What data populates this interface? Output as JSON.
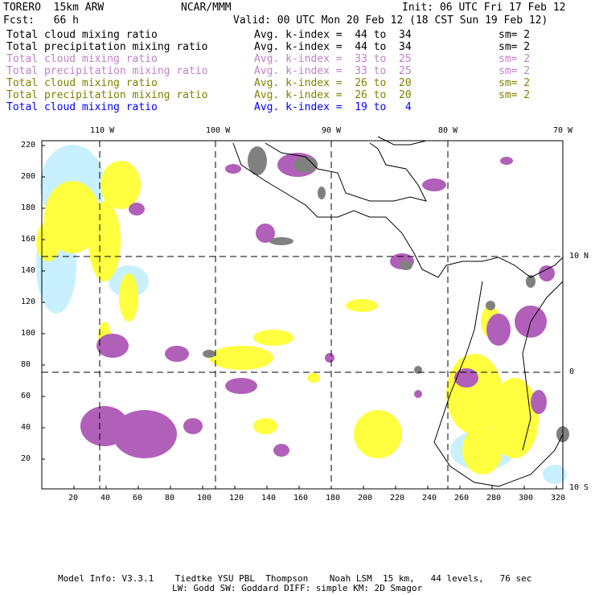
{
  "header": {
    "model": "TORERO  15km ARW",
    "org": "NCAR/MMM",
    "init": "Init: 06 UTC Fri 17 Feb 12",
    "fcst": "Fcst:   66 h",
    "valid": "Valid: 00 UTC Mon 20 Feb 12 (18 CST Sun 19 Feb 12)"
  },
  "legend": [
    {
      "field": "Total cloud mixing ratio",
      "index": "Avg. k-index =  44 to  34",
      "sm": "sm= 2",
      "color": "#000000"
    },
    {
      "field": "Total precipitation mixing ratio",
      "index": "Avg. k-index =  44 to  34",
      "sm": "sm= 2",
      "color": "#000000"
    },
    {
      "field": "Total cloud mixing ratio",
      "index": "Avg. k-index =  33 to  25",
      "sm": "sm= 2",
      "color": "#c080c8"
    },
    {
      "field": "Total precipitation mixing ratio",
      "index": "Avg. k-index =  33 to  25",
      "sm": "sm= 2",
      "color": "#c080c8"
    },
    {
      "field": "Total cloud mixing ratio",
      "index": "Avg. k-index =  26 to  20",
      "sm": "sm= 2",
      "color": "#808000"
    },
    {
      "field": "Total precipitation mixing ratio",
      "index": "Avg. k-index =  26 to  20",
      "sm": "sm= 2",
      "color": "#808000"
    },
    {
      "field": "Total cloud mixing ratio",
      "index": "Avg. k-index =  19 to   4",
      "sm": "",
      "color": "#0000ff"
    }
  ],
  "map": {
    "lon_labels": [
      "110 W",
      "100 W",
      "90 W",
      "80 W",
      "70 W"
    ],
    "lat_labels": [
      "10 N",
      "0",
      "10 S"
    ],
    "x_ticks": [
      "20",
      "40",
      "60",
      "80",
      "100",
      "120",
      "140",
      "160",
      "180",
      "200",
      "220",
      "240",
      "260",
      "280",
      "300",
      "320"
    ],
    "y_ticks": [
      "20",
      "40",
      "60",
      "80",
      "100",
      "120",
      "140",
      "160",
      "180",
      "200",
      "220"
    ],
    "colors": {
      "high": "#808080",
      "mid": "#b060b8",
      "low": "#ffff40",
      "lowest": "#c8f0ff"
    }
  },
  "footer": {
    "line1": "Model Info: V3.3.1    Tiedtke YSU PBL  Thompson    Noah LSM  15 km,   44 levels,   76 sec",
    "line2": "LW: Godd SW: Goddard DIFF: simple KM: 2D Smagor"
  }
}
